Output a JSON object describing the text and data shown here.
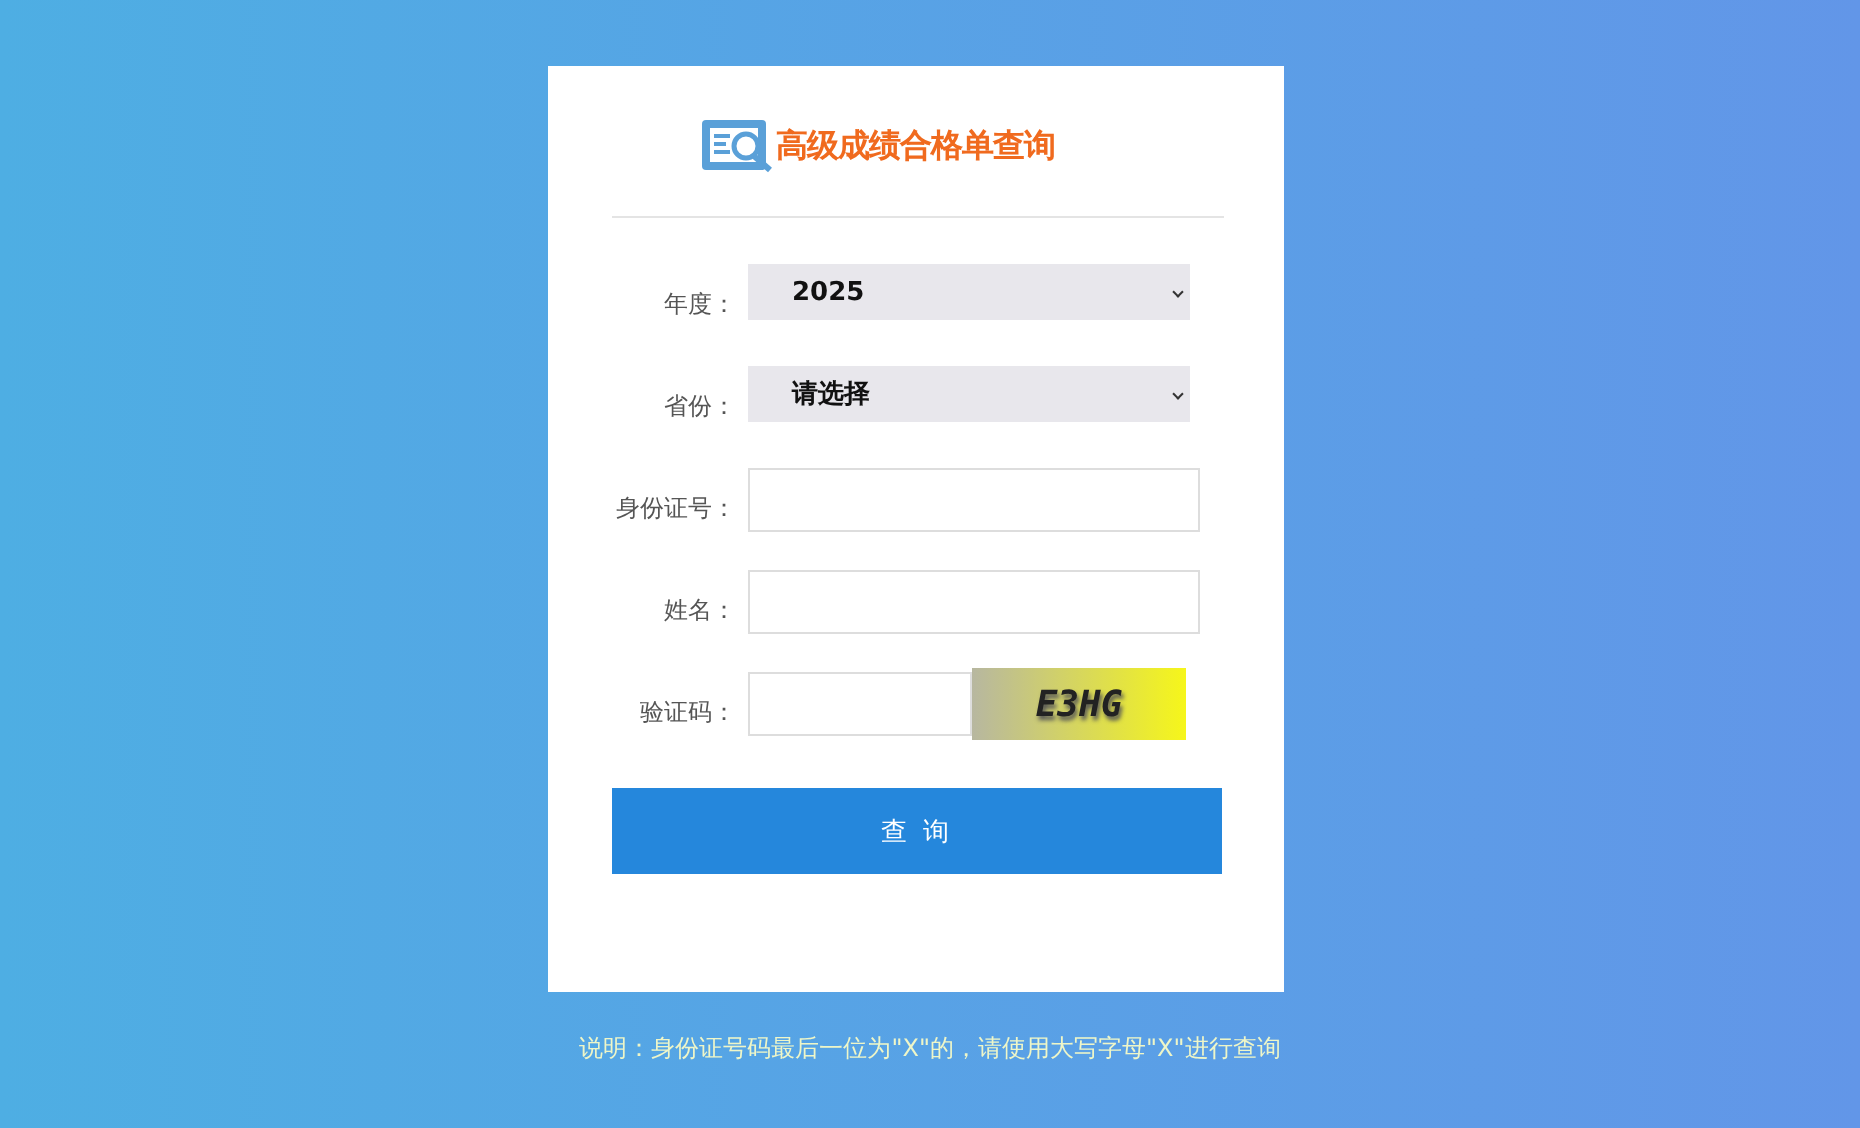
{
  "title": "高级成绩合格单查询",
  "fields": [
    {
      "kind": "select",
      "label": "年度：",
      "value": "2025"
    },
    {
      "kind": "select",
      "label": "省份：",
      "value": "请选择"
    },
    {
      "kind": "input",
      "label": "身份证号："
    },
    {
      "kind": "input",
      "label": "姓名："
    },
    {
      "kind": "captcha",
      "label": "验证码：",
      "captcha": "E3HG"
    }
  ],
  "button": "查 询",
  "note": "说明：身份证号码最后一位为\"X\"的，请使用大写字母\"X\"进行查询"
}
